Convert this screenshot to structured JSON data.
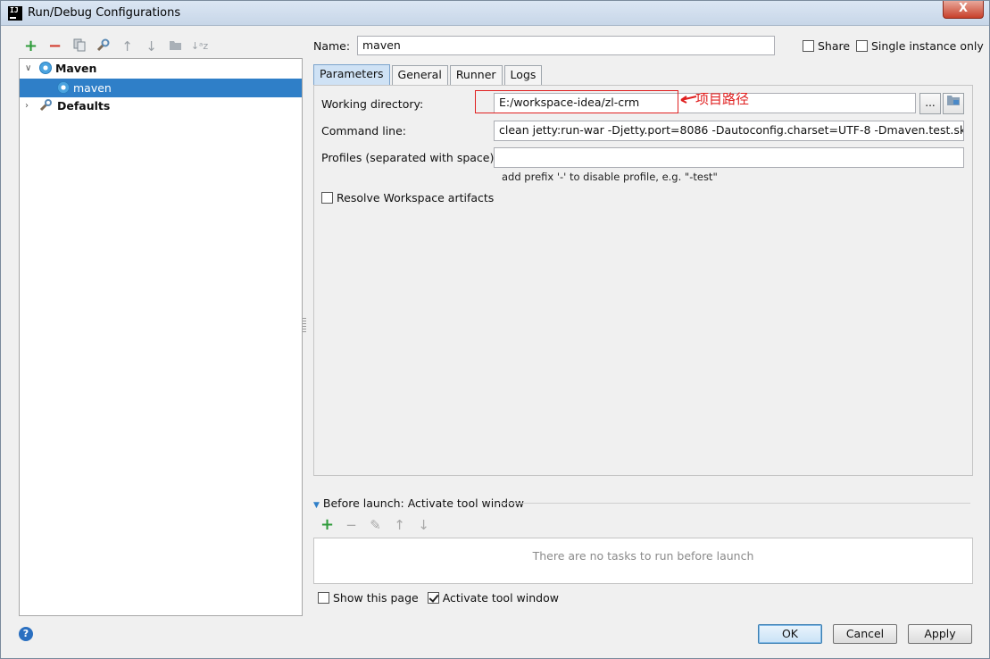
{
  "window": {
    "title": "Run/Debug Configurations",
    "close": "X"
  },
  "toolbar": {
    "icons": [
      "plus-icon",
      "minus-icon",
      "copy-icon",
      "wrench-icon",
      "arrow-up-icon",
      "arrow-down-icon",
      "folder-icon",
      "sort-az-icon"
    ]
  },
  "tree": {
    "items": [
      {
        "label": "Maven",
        "expanded": true
      },
      {
        "label": "maven",
        "selected": true
      },
      {
        "label": "Defaults",
        "expanded": false
      }
    ]
  },
  "name": {
    "label": "Name:",
    "value": "maven"
  },
  "share": {
    "label": "Share",
    "checked": false
  },
  "single_instance": {
    "label": "Single instance only",
    "checked": false
  },
  "tabs": [
    "Parameters",
    "General",
    "Runner",
    "Logs"
  ],
  "active_tab": "Parameters",
  "params": {
    "working_dir_label": "Working directory:",
    "working_dir_value": "E:/workspace-idea/zl-crm",
    "browse_label": "...",
    "command_label": "Command line:",
    "command_value": "clean jetty:run-war -Djetty.port=8086 -Dautoconfig.charset=UTF-8 -Dmaven.test.skip",
    "profiles_label": "Profiles (separated with space):",
    "profiles_value": "",
    "profiles_hint": "add prefix '-' to disable profile, e.g. \"-test\"",
    "resolve_label": "Resolve Workspace artifacts",
    "resolve_checked": false
  },
  "annotation": {
    "text": "项目路径",
    "color": "#e02020"
  },
  "before_launch": {
    "title": "Before launch: Activate tool window",
    "empty_text": "There are no tasks to run before launch",
    "show_page_label": "Show this page",
    "show_page_checked": false,
    "activate_label": "Activate tool window",
    "activate_checked": true
  },
  "buttons": {
    "ok": "OK",
    "cancel": "Cancel",
    "apply": "Apply",
    "help": "?"
  },
  "colors": {
    "selection": "#2f7fc8",
    "accent_green": "#2e9b3a",
    "accent_red": "#d23a2c"
  }
}
